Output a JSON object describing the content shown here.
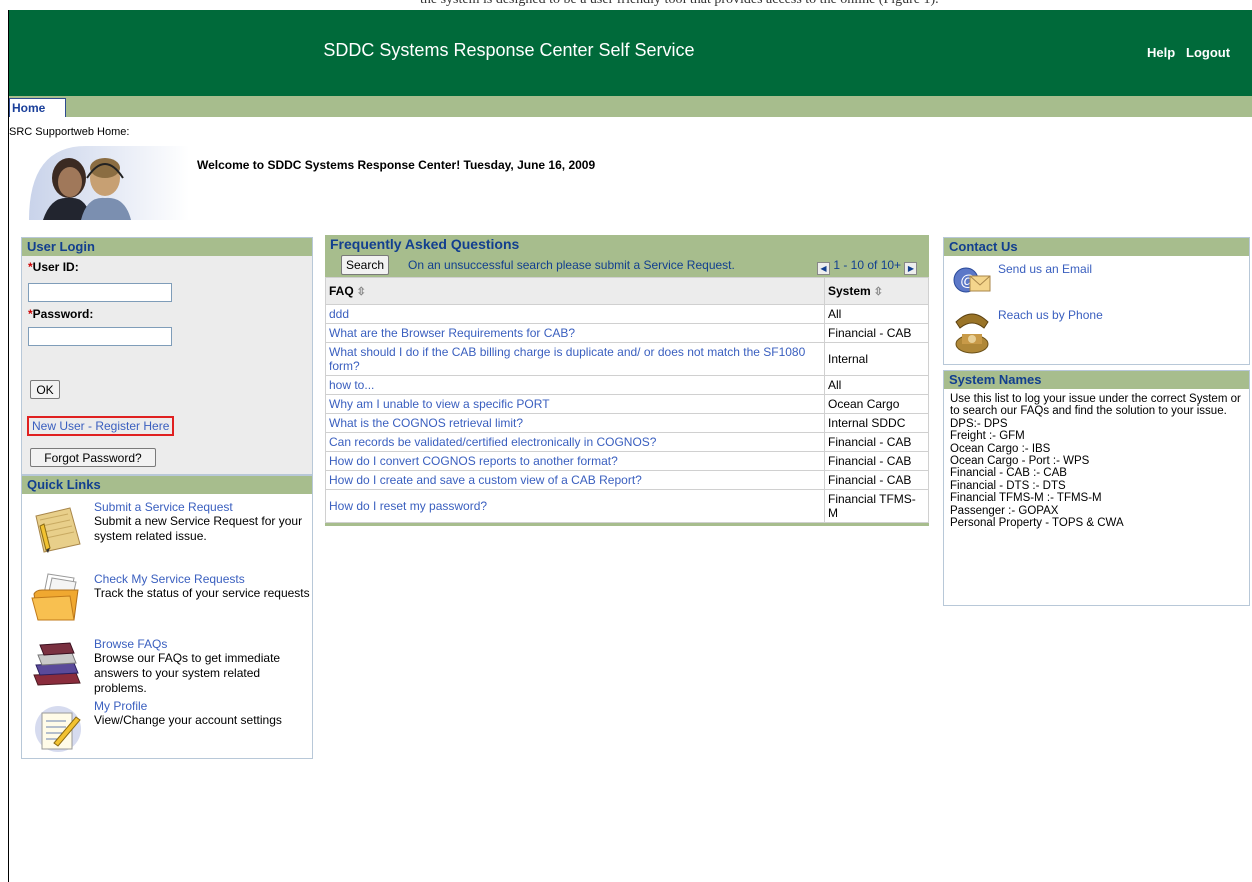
{
  "top_fragment": "the system is designed to be a user friendly tool that provides access to the online (Figure 1).",
  "header": {
    "title": "SDDC Systems Response Center Self Service",
    "help": "Help",
    "logout": "Logout"
  },
  "tabs": {
    "home": "Home"
  },
  "breadcrumb": "SRC Supportweb Home:",
  "welcome": "Welcome to SDDC Systems Response Center! Tuesday, June 16, 2009",
  "login": {
    "heading": "User Login",
    "required_marker": "*",
    "user_label": "User ID:",
    "user_value": "",
    "password_label": "Password:",
    "password_value": "",
    "ok_label": "OK",
    "new_user_link": "New User - Register Here",
    "forgot_label": "Forgot Password?"
  },
  "quick_links": {
    "heading": "Quick Links",
    "items": [
      {
        "title": "Submit a Service Request",
        "desc": "Submit a new Service Request for your system related issue."
      },
      {
        "title": "Check My Service Requests",
        "desc": "Track the status of your service requests"
      },
      {
        "title": "Browse FAQs",
        "desc": "Browse our FAQs to get immediate answers to your system related problems."
      },
      {
        "title": "My Profile",
        "desc": "View/Change your account settings"
      }
    ]
  },
  "faq": {
    "heading": "Frequently Asked Questions",
    "search_label": "Search",
    "hint": "On an unsuccessful search please submit a Service Request.",
    "pager": "1 - 10 of 10+",
    "col_faq": "FAQ",
    "col_system": "System",
    "rows": [
      {
        "q": "ddd",
        "s": "All"
      },
      {
        "q": "What are the Browser Requirements for CAB?",
        "s": "Financial - CAB"
      },
      {
        "q": "What should I do if the CAB billing charge is duplicate and/ or does not match the SF1080 form?",
        "s": "Internal"
      },
      {
        "q": "how to...",
        "s": "All"
      },
      {
        "q": "Why am I unable to view a specific PORT",
        "s": "Ocean Cargo"
      },
      {
        "q": "What is the COGNOS retrieval limit?",
        "s": "Internal SDDC"
      },
      {
        "q": "Can records be validated/certified electronically in COGNOS?",
        "s": "Financial - CAB"
      },
      {
        "q": "How do I convert COGNOS reports to another format?",
        "s": "Financial - CAB"
      },
      {
        "q": "How do I create and save a custom view of a CAB Report?",
        "s": "Financial - CAB"
      },
      {
        "q": "How do I reset my password?",
        "s": "Financial TFMS-M"
      }
    ]
  },
  "contact": {
    "heading": "Contact Us",
    "email": "Send us an Email",
    "phone": "Reach us by Phone"
  },
  "system_names": {
    "heading": "System Names",
    "intro": "Use this list to log your issue under the correct System or to search our FAQs and find the solution to your issue.",
    "items": [
      "DPS:- DPS",
      "Freight :- GFM",
      "Ocean Cargo :- IBS",
      "Ocean Cargo - Port :- WPS",
      "Financial - CAB :- CAB",
      "Financial - DTS :- DTS",
      "Financial TFMS-M :- TFMS-M",
      "Passenger :- GOPAX",
      "Personal Property - TOPS & CWA"
    ]
  },
  "colors": {
    "header_green": "#006a3a",
    "panel_green": "#a7bd8d",
    "link_blue": "#3a5fbf"
  }
}
